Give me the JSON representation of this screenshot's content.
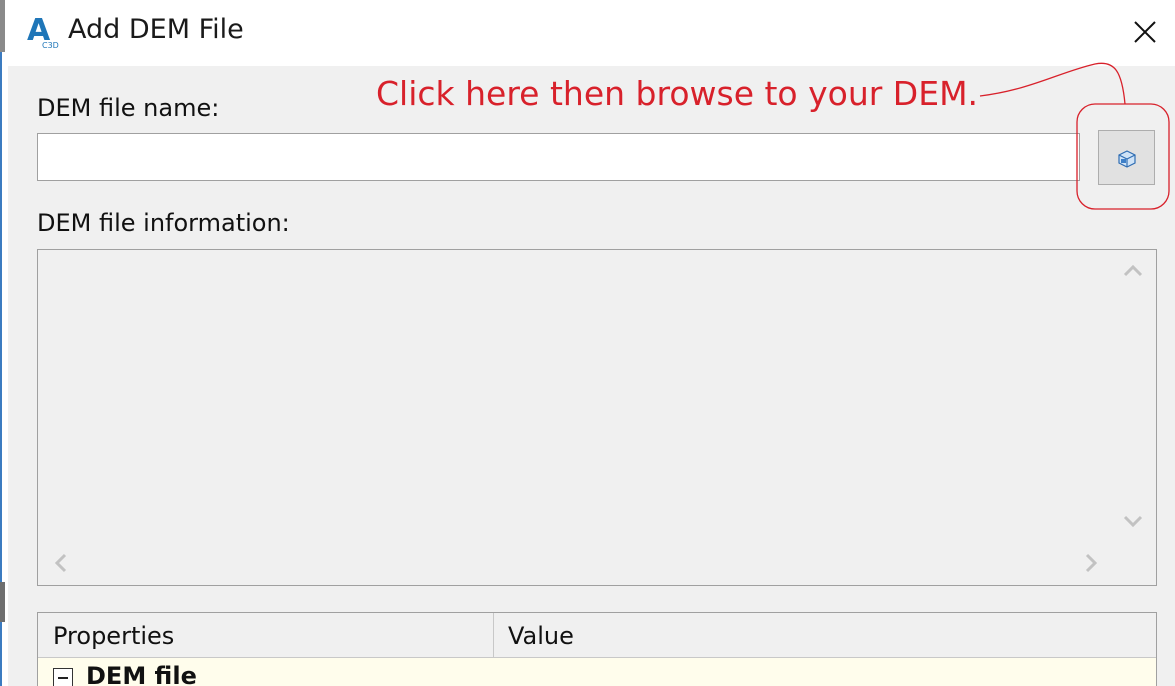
{
  "window": {
    "title": "Add DEM File",
    "app_icon": "autocad-civil3d-icon",
    "app_icon_text": "A",
    "app_icon_subtext": "C3D"
  },
  "form": {
    "filename_label": "DEM file name:",
    "filename_value": "",
    "info_label": "DEM file information:"
  },
  "annotation": {
    "text": "Click here then browse to your DEM.",
    "color": "#d8212b"
  },
  "properties": {
    "col_properties": "Properties",
    "col_value": "Value",
    "rows": [
      {
        "label": "DEM file",
        "value": "",
        "expanded": true
      }
    ]
  }
}
